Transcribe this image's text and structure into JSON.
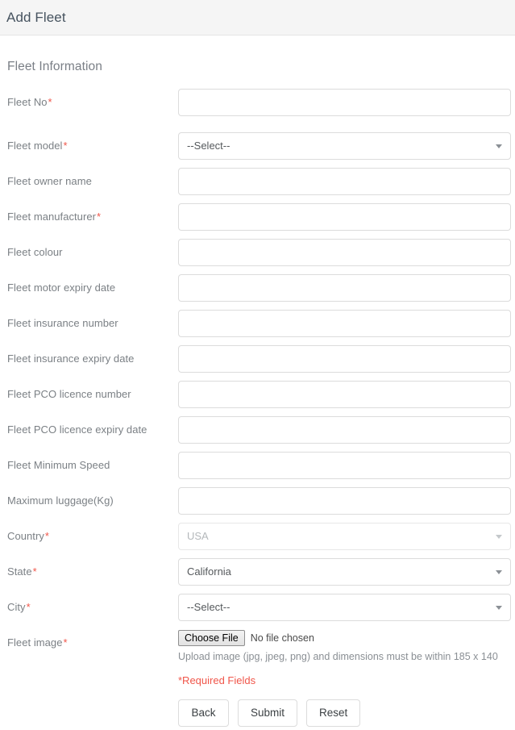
{
  "header": {
    "title": "Add Fleet"
  },
  "section": {
    "title": "Fleet Information"
  },
  "fields": [
    {
      "label": "Fleet No",
      "required": true,
      "type": "text",
      "value": ""
    },
    {
      "label": "Fleet model",
      "required": true,
      "type": "select",
      "value": "--Select--"
    },
    {
      "label": "Fleet owner name",
      "required": false,
      "type": "text",
      "value": ""
    },
    {
      "label": "Fleet manufacturer",
      "required": true,
      "type": "text",
      "value": ""
    },
    {
      "label": "Fleet colour",
      "required": false,
      "type": "text",
      "value": ""
    },
    {
      "label": "Fleet motor expiry date",
      "required": false,
      "type": "text",
      "value": ""
    },
    {
      "label": "Fleet insurance number",
      "required": false,
      "type": "text",
      "value": ""
    },
    {
      "label": "Fleet insurance expiry date",
      "required": false,
      "type": "text",
      "value": ""
    },
    {
      "label": "Fleet PCO licence number",
      "required": false,
      "type": "text",
      "value": ""
    },
    {
      "label": "Fleet PCO licence expiry date",
      "required": false,
      "type": "text",
      "value": ""
    },
    {
      "label": "Fleet Minimum Speed",
      "required": false,
      "type": "text",
      "value": ""
    },
    {
      "label": "Maximum luggage(Kg)",
      "required": false,
      "type": "text",
      "value": ""
    },
    {
      "label": "Country",
      "required": true,
      "type": "select",
      "value": "USA",
      "disabled": true
    },
    {
      "label": "State",
      "required": true,
      "type": "select",
      "value": "California"
    },
    {
      "label": "City",
      "required": true,
      "type": "select",
      "value": "--Select--"
    }
  ],
  "labels": {
    "fleet_no": "Fleet No",
    "fleet_model": "Fleet model",
    "fleet_owner_name": "Fleet owner name",
    "fleet_manufacturer": "Fleet manufacturer",
    "fleet_colour": "Fleet colour",
    "fleet_motor_expiry_date": "Fleet motor expiry date",
    "fleet_insurance_number": "Fleet insurance number",
    "fleet_insurance_expiry_date": "Fleet insurance expiry date",
    "fleet_pco_licence_number": "Fleet PCO licence number",
    "fleet_pco_licence_expiry_date": "Fleet PCO licence expiry date",
    "fleet_minimum_speed": "Fleet Minimum Speed",
    "maximum_luggage": "Maximum luggage(Kg)",
    "country": "Country",
    "state": "State",
    "city": "City",
    "fleet_image": "Fleet image"
  },
  "values": {
    "fleet_model": "--Select--",
    "country": "USA",
    "state": "California",
    "city": "--Select--"
  },
  "required_marker": "*",
  "upload": {
    "button_label": "Choose File",
    "status": "No file chosen",
    "hint": "Upload image (jpg, jpeg, png) and dimensions must be within 185 x 140"
  },
  "required_note": "*Required Fields",
  "buttons": {
    "back": "Back",
    "submit": "Submit",
    "reset": "Reset"
  },
  "colors": {
    "header_bg": "#f5f5f5",
    "header_text": "#46535f",
    "label_text": "#7b8085",
    "required_red": "#f0564a",
    "border": "#dcdcdc"
  }
}
